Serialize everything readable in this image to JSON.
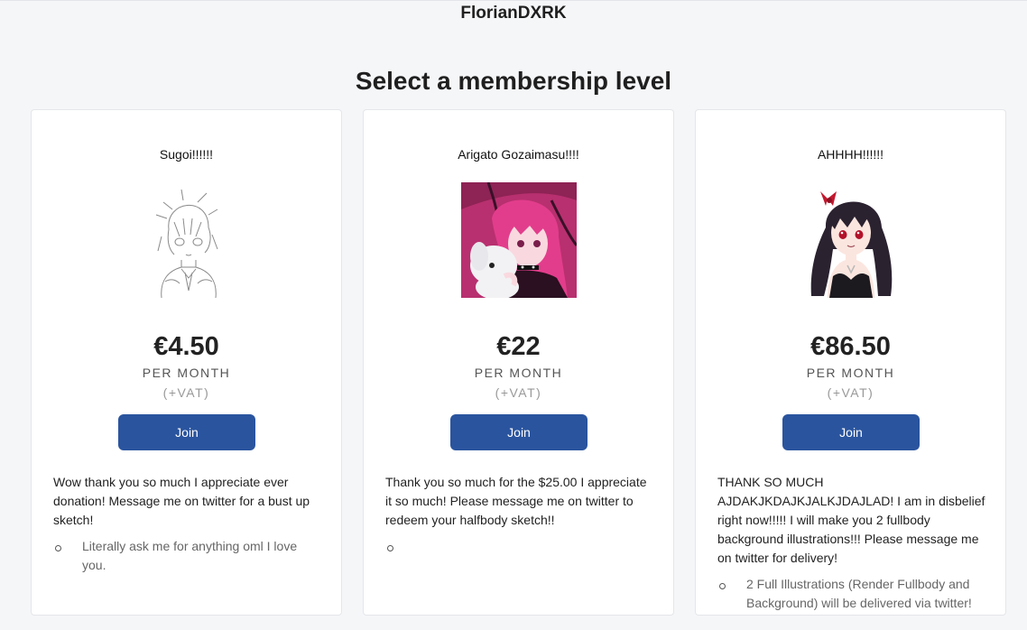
{
  "header": {
    "creator_name": "FlorianDXRK",
    "title": "Select a membership level"
  },
  "tiers": [
    {
      "name": "Sugoi!!!!!!",
      "image": "sketch-avatar",
      "price": "€4.50",
      "period": "PER MONTH",
      "vat": "(+VAT)",
      "join_label": "Join",
      "description": "Wow thank you so much I appreciate ever donation! Message me on twitter for a bust up sketch!",
      "benefits": [
        "Literally ask me for anything oml I love you."
      ]
    },
    {
      "name": "Arigato Gozaimasu!!!!",
      "image": "pink-hair-avatar",
      "price": "€22",
      "period": "PER MONTH",
      "vat": "(+VAT)",
      "join_label": "Join",
      "description": "Thank you so much for the $25.00 I appreciate it so much! Please message me on twitter to redeem your halfbody sketch!!",
      "benefits": [
        ""
      ]
    },
    {
      "name": "AHHHH!!!!!!",
      "image": "dark-hair-avatar",
      "price": "€86.50",
      "period": "PER MONTH",
      "vat": "(+VAT)",
      "join_label": "Join",
      "description": "THANK SO MUCH AJDAKJKDAJKJALKJDAJLAD! I am in disbelief right now!!!!! I will make you 2 fullbody background illustrations!!! Please message me on twitter for delivery!",
      "benefits": [
        "2 Full Illustrations (Render Fullbody and Background) will be delivered via twitter!"
      ]
    }
  ],
  "colors": {
    "page_background": "#f5f6f8",
    "card_background": "#ffffff",
    "join_button": "#2a549e",
    "tier2_image_background": "#b8306f"
  }
}
